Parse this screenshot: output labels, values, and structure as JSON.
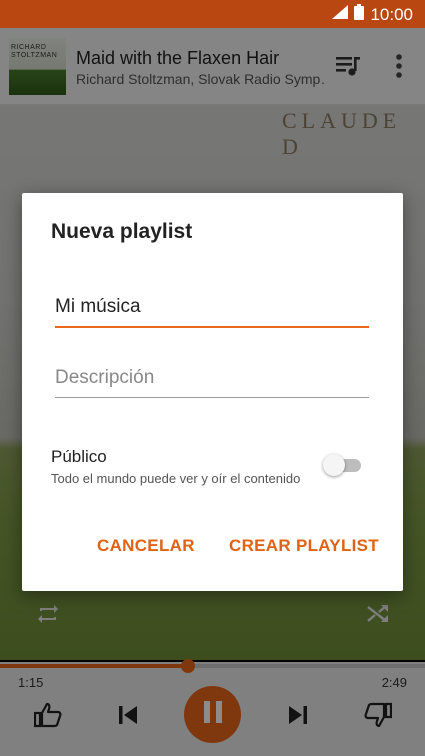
{
  "status_bar": {
    "time": "10:00"
  },
  "now_playing": {
    "album_art_text": [
      "RICHARD",
      "STOLTZMAN"
    ],
    "title": "Maid with the Flaxen Hair",
    "artist": "Richard Stoltzman, Slovak Radio Symp…"
  },
  "background_art": {
    "text": "CLAUDE D"
  },
  "dialog": {
    "title": "Nueva playlist",
    "name_field": {
      "value": "Mi música",
      "placeholder": ""
    },
    "description_field": {
      "value": "",
      "placeholder": "Descripción"
    },
    "public": {
      "label": "Público",
      "sublabel": "Todo el mundo puede ver y oír el contenido",
      "enabled": false
    },
    "cancel_label": "CANCELAR",
    "create_label": "CREAR PLAYLIST"
  },
  "player": {
    "elapsed": "1:15",
    "duration": "2:49",
    "progress_fraction": 0.443
  },
  "colors": {
    "accent": "#e8671b",
    "status_bar": "#b84712",
    "button_text": "#e06215"
  },
  "icons": [
    "signal-icon",
    "battery-icon",
    "queue-icon",
    "more-vert-icon",
    "repeat-icon",
    "shuffle-icon",
    "thumbs-up-icon",
    "skip-previous-icon",
    "pause-icon",
    "skip-next-icon",
    "thumbs-down-icon"
  ]
}
